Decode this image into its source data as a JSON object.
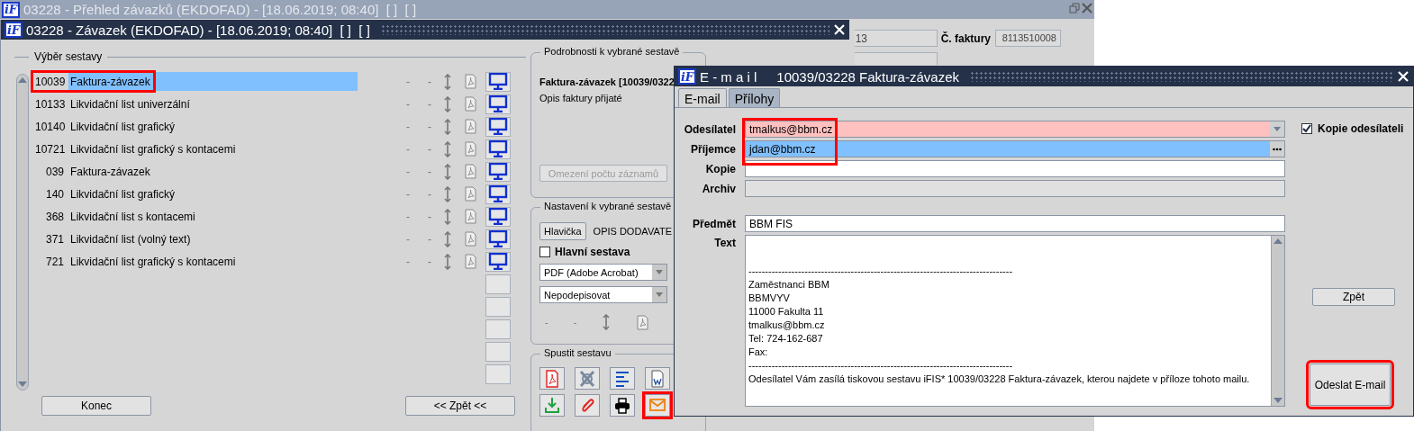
{
  "background_window": {
    "logo": "iF",
    "title": "03228 - Přehled závazků (EKDOFAD) - [18.06.2019; 08:40]  [ ]  [ ]",
    "partial_field": {
      "value": "13"
    },
    "invoice_number": {
      "label": "Č. faktury",
      "value": "8113510008"
    }
  },
  "main_window": {
    "logo": "iF",
    "title": "03228 - Závazek (EKDOFAD) - [18.06.2019; 08:40]  [ ]  [ ]",
    "report_selection": {
      "legend": "Výběr sestavy",
      "rows": [
        {
          "number": "10039",
          "name": "Faktura-závazek",
          "selected": true,
          "highlighted": true,
          "column_3": "-",
          "column_4": "-"
        },
        {
          "number": "10133",
          "name": "Likvidační list univerzální",
          "selected": false,
          "highlighted": false,
          "column_3": "-",
          "column_4": "-"
        },
        {
          "number": "10140",
          "name": "Likvidační list grafický",
          "selected": false,
          "highlighted": false,
          "column_3": "-",
          "column_4": "-"
        },
        {
          "number": "10721",
          "name": "Likvidační list grafický s kontacemi",
          "selected": false,
          "highlighted": false,
          "column_3": "-",
          "column_4": "-"
        },
        {
          "number": "039",
          "name": "Faktura-závazek",
          "selected": false,
          "highlighted": false,
          "column_3": "-",
          "column_4": "-"
        },
        {
          "number": "140",
          "name": "Likvidační list grafický",
          "selected": false,
          "highlighted": false,
          "column_3": "-",
          "column_4": "-"
        },
        {
          "number": "368",
          "name": "Likvidační list s kontacemi",
          "selected": false,
          "highlighted": false,
          "column_3": "-",
          "column_4": "-"
        },
        {
          "number": "371",
          "name": "Likvidační list (volný text)",
          "selected": false,
          "highlighted": false,
          "column_3": "-",
          "column_4": "-"
        },
        {
          "number": "721",
          "name": "Likvidační list grafický s kontacemi",
          "selected": false,
          "highlighted": false,
          "column_3": "-",
          "column_4": "-"
        }
      ]
    },
    "buttons": [
      {
        "label": "Konec"
      },
      {
        "label": "<< Zpět <<"
      }
    ],
    "details": {
      "legend": "Podrobnosti k vybrané sestavě",
      "title": "Faktura-závazek [10039/0322",
      "description": "Opis faktury přijaté",
      "limit_button": {
        "label": "Omezení počtu záznamů",
        "disabled": true
      }
    },
    "settings": {
      "legend": "Nastavení k vybrané sestavě",
      "header_button": "Hlavička",
      "header_value": "OPIS DODAVATE",
      "main_report": {
        "label": "Hlavní sestava",
        "checked": false
      },
      "format_select": "PDF (Adobe Acrobat)",
      "signature_select": "Nepodepisovat",
      "column_3": "-",
      "column_4": "-"
    },
    "run": {
      "legend": "Spustit sestavu",
      "buttons": [
        {
          "kind": "pdf",
          "highlighted": false
        },
        {
          "kind": "export",
          "highlighted": false
        },
        {
          "kind": "text",
          "highlighted": false
        },
        {
          "kind": "document",
          "highlighted": false
        },
        {
          "kind": "download",
          "highlighted": false
        },
        {
          "kind": "attach",
          "highlighted": false
        },
        {
          "kind": "print",
          "highlighted": false
        },
        {
          "kind": "email",
          "highlighted": true
        }
      ]
    }
  },
  "email_window": {
    "logo": "iF",
    "title_prefix": "E - m a i l",
    "title": "10039/03228 Faktura-závazek",
    "tabs": [
      {
        "label": "E-mail",
        "selected": true
      },
      {
        "label": "Přílohy",
        "selected": false
      }
    ],
    "address_fields": [
      {
        "label": "Odesílatel",
        "value": "tmalkus@bbm.cz",
        "kind": "dropdown",
        "required": true,
        "focused": false
      },
      {
        "label": "Příjemce",
        "value": "jdan@bbm.cz",
        "kind": "lookup",
        "required": false,
        "focused": true
      },
      {
        "label": "Kopie",
        "kind": "text",
        "required": false,
        "focused": false
      },
      {
        "label": "Archiv",
        "kind": "readonly",
        "required": false,
        "focused": false
      }
    ],
    "address_highlight": true,
    "subject": {
      "label": "Předmět",
      "value": "BBM FIS"
    },
    "text": {
      "label": "Text",
      "value": "\n\n--------------------------------------------------------------------------------\nZaměstnanci BBM\nBBMVYV\n11000 Fakulta 11\ntmalkus@bbm.cz\nTel: 724-162-687\nFax:\n--------------------------------------------------------------------------------\nOdesílatel Vám zasílá tiskovou sestavu iFIS* 10039/03228 Faktura-závazek, kterou najdete v příloze tohoto mailu."
    },
    "copy_to_sender": {
      "label": "Kopie odesílateli",
      "checked": true
    },
    "back_button": {
      "label": "Zpět"
    },
    "send_button": {
      "label": "Odeslat E-mail",
      "highlighted": true
    }
  }
}
